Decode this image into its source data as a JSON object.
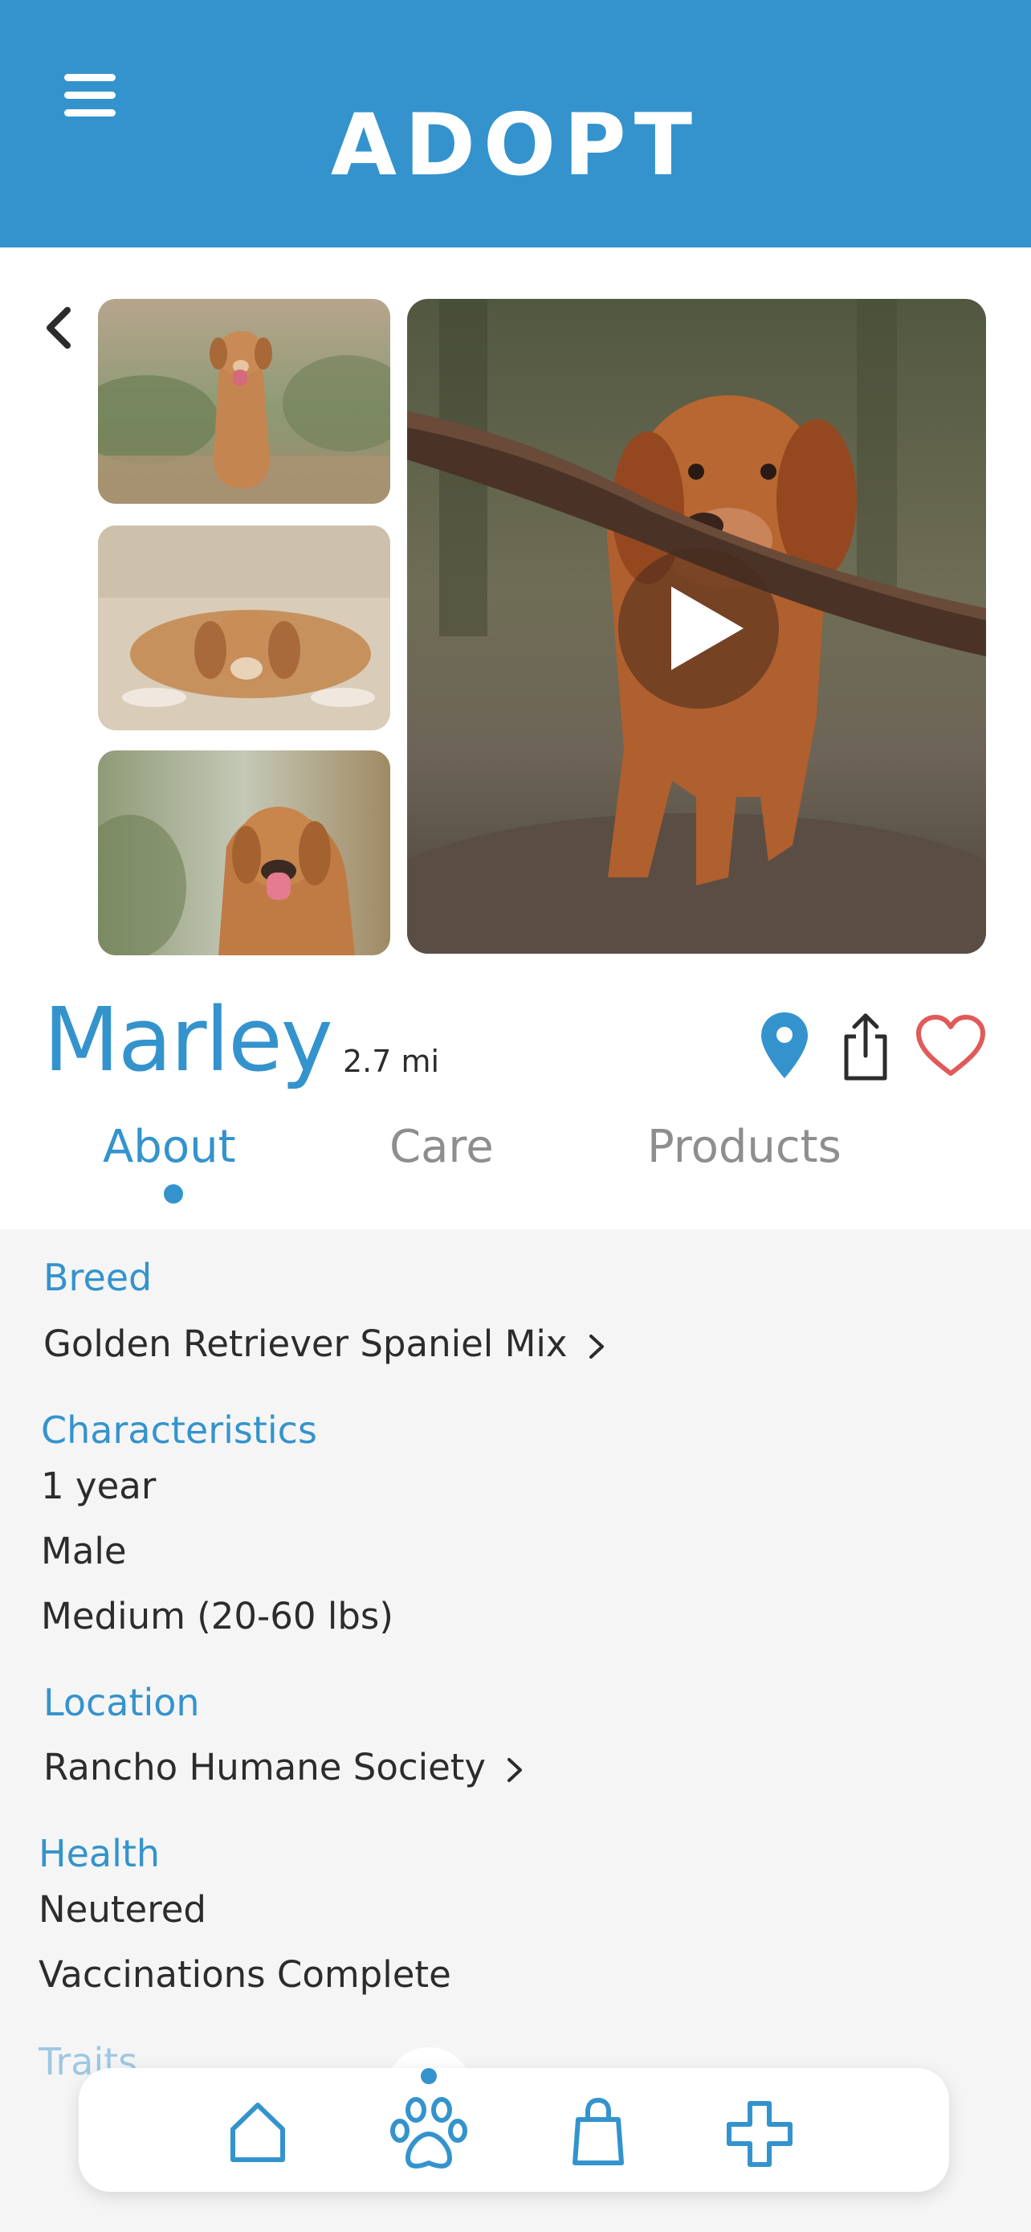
{
  "header": {
    "title": "ADOPT",
    "menu_icon": "hamburger-menu-icon",
    "background_color": "#3493cd"
  },
  "gallery": {
    "back_icon": "chevron-left-icon",
    "thumbnails": [
      "dog-photo-sitting",
      "dog-photo-lying",
      "dog-photo-smiling"
    ],
    "main_media": "dog-video-with-stick",
    "play_icon": "play-icon"
  },
  "pet": {
    "name": "Marley",
    "distance": "2.7 mi",
    "actions": [
      "location-pin-icon",
      "share-icon",
      "heart-icon"
    ]
  },
  "tabs": [
    {
      "label": "About",
      "active": true
    },
    {
      "label": "Care",
      "active": false
    },
    {
      "label": "Products",
      "active": false
    }
  ],
  "about": {
    "breed": {
      "label": "Breed",
      "value": "Golden Retriever Spaniel Mix"
    },
    "characteristics": {
      "label": "Characteristics",
      "values": [
        "1 year",
        "Male",
        "Medium (20-60 lbs)"
      ]
    },
    "location": {
      "label": "Location",
      "value": "Rancho Humane Society"
    },
    "health": {
      "label": "Health",
      "values": [
        "Neutered",
        "Vaccinations Complete"
      ]
    },
    "traits": {
      "label": "Traits"
    }
  },
  "bottom_nav": {
    "items": [
      "home-icon",
      "paw-icon",
      "shopping-bag-icon",
      "medical-cross-icon"
    ],
    "active": "paw-icon"
  },
  "colors": {
    "accent": "#3493cd",
    "favorite": "#e05a5a",
    "text": "#2c2c2c",
    "muted": "#8e8e8e"
  }
}
